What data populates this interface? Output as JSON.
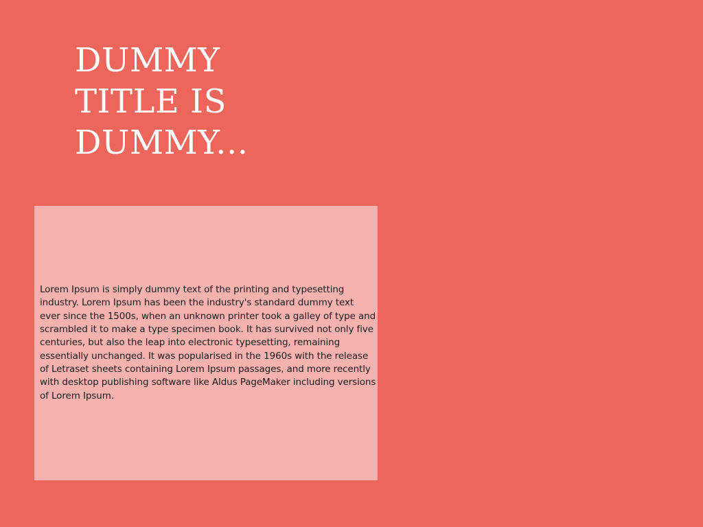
{
  "slide": {
    "title_lines": [
      "DUMMY",
      "TITLE IS",
      "DUMMY..."
    ],
    "body": "Lorem Ipsum is simply dummy text of the printing and typesetting industry. Lorem Ipsum has been the industry's standard dummy text ever since the 1500s, when an unknown printer took a galley of type and scrambled it to make a type specimen book. It has survived not only five centuries, but also the leap into electronic typesetting, remaining essentially unchanged. It was popularised in the 1960s with the release of Letraset sheets containing Lorem Ipsum passages, and more recently with desktop publishing software like Aldus PageMaker including versions of Lorem Ipsum."
  },
  "colors": {
    "background": "#ec665c",
    "content_box": "#f5b2ae",
    "title_text": "#ffffff",
    "body_text": "#1a1a1a"
  }
}
